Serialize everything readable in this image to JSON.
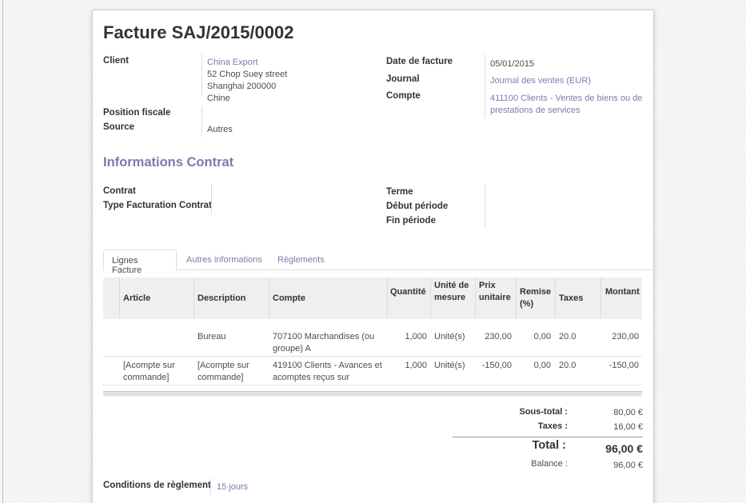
{
  "invoice": {
    "title": "Facture SAJ/2015/0002"
  },
  "header_left": {
    "client_label": "Client",
    "client_name": "China Export",
    "client_address": [
      "52 Chop Suey street",
      "Shanghai 200000",
      "Chine"
    ],
    "fiscal_position_label": "Position fiscale",
    "source_label": "Source",
    "source_value": "Autres"
  },
  "header_right": {
    "date_label": "Date de facture",
    "date_value": "05/01/2015",
    "journal_label": "Journal",
    "journal_value": "Journal des ventes (EUR)",
    "account_label": "Compte",
    "account_value": [
      "411100 Clients - Ventes de biens ou de",
      "prestations de services"
    ]
  },
  "contract": {
    "section_title": "Informations Contrat",
    "contract_label": "Contrat",
    "billing_type_label": "Type Facturation Contrat",
    "term_label": "Terme",
    "period_start_label": "Début période",
    "period_end_label": "Fin période"
  },
  "tabs": [
    {
      "label": "Lignes Facture",
      "active": true
    },
    {
      "label": "Autres informations",
      "active": false
    },
    {
      "label": "Règlements",
      "active": false
    }
  ],
  "table": {
    "columns": {
      "article": "Article",
      "description": "Description",
      "account": "Compte",
      "quantity": "Quantité",
      "unit": [
        "Unité de",
        "mesure"
      ],
      "unit_price": [
        "Prix",
        "unitaire"
      ],
      "discount": [
        "Remise",
        "(%)"
      ],
      "taxes": "Taxes",
      "amount": "Montant"
    },
    "rows": [
      {
        "article": [
          ""
        ],
        "description": [
          "Bureau"
        ],
        "account": [
          "707100 Marchandises (ou",
          "groupe) A"
        ],
        "quantity": "1,000",
        "unit": "Unité(s)",
        "unit_price": "230,00",
        "discount": "0,00",
        "taxes": "20.0",
        "amount": "230,00"
      },
      {
        "article": [
          "[Acompte sur",
          "commande]"
        ],
        "description": [
          "[Acompte sur",
          "commande]"
        ],
        "account": [
          "419100 Clients - Avances et",
          "acomptes reçus sur"
        ],
        "quantity": "1,000",
        "unit": "Unité(s)",
        "unit_price": "-150,00",
        "discount": "0,00",
        "taxes": "20.0",
        "amount": "-150,00"
      }
    ]
  },
  "totals": {
    "subtotal_label": "Sous-total :",
    "subtotal_value": "80,00 €",
    "taxes_label": "Taxes :",
    "taxes_value": "16,00 €",
    "total_label": "Total :",
    "total_value": "96,00 €",
    "balance_label": "Balance :",
    "balance_value": "96,00 €"
  },
  "payment_terms": {
    "label": "Conditions de règlement",
    "value": "15 jours"
  },
  "colors": {
    "accent": "#7c7bad",
    "text": "#4c4c4c"
  }
}
